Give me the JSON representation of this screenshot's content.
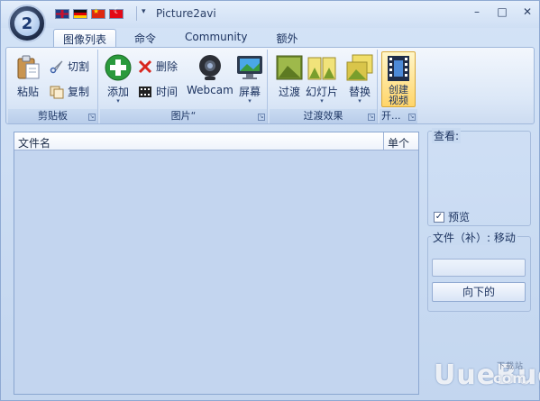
{
  "window": {
    "title": "Picture2avi",
    "controls": [
      "–",
      "□",
      "✕"
    ]
  },
  "app_orb": {
    "glyph": "2"
  },
  "flags": [
    "uk",
    "de",
    "cn",
    "tr"
  ],
  "qat": {
    "dropdown": "▾"
  },
  "tabs": [
    {
      "label": "图像列表",
      "active": true
    },
    {
      "label": "命令"
    },
    {
      "label": "Community"
    },
    {
      "label": "额外"
    }
  ],
  "ribbon": {
    "clipboard": {
      "label": "剪贴板",
      "paste": "粘贴",
      "cut": "切割",
      "copy": "复制"
    },
    "pictures": {
      "label": "图片“",
      "add": "添加",
      "delete": "删除",
      "time": "时间",
      "webcam": "Webcam",
      "screen": "屏幕"
    },
    "transitions": {
      "label": "过渡效果",
      "transition": "过渡",
      "slideshow": "幻灯片",
      "replace": "替换"
    },
    "open": {
      "label": "开...",
      "create_video": "创建\n视频"
    }
  },
  "list": {
    "columns": [
      "文件名",
      "单个"
    ]
  },
  "preview": {
    "title": "查看:",
    "checkbox_label": "预览",
    "checked": true
  },
  "file_group": {
    "title": "文件（补）: 移动",
    "input_value": "",
    "down_button": "向下的"
  },
  "watermark": {
    "main": "U",
    "brand": "ueBug",
    "com": "com",
    "sub": "下载站"
  },
  "colors": {
    "accent": "#1c3360",
    "ribbon_border": "#9fb8db",
    "list_bg": "#c3d5ef"
  }
}
